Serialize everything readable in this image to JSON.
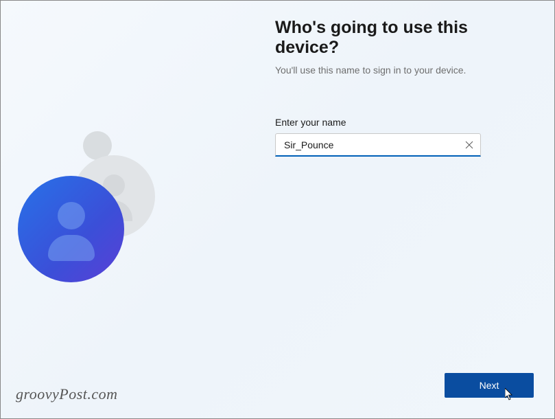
{
  "heading": "Who's going to use this device?",
  "subtext": "You'll use this name to sign in to your device.",
  "input": {
    "label": "Enter your name",
    "value": "Sir_Pounce"
  },
  "buttons": {
    "next": "Next"
  },
  "watermark": "groovyPost.com",
  "colors": {
    "accent": "#0060b8",
    "button_bg": "#0a4da0"
  }
}
